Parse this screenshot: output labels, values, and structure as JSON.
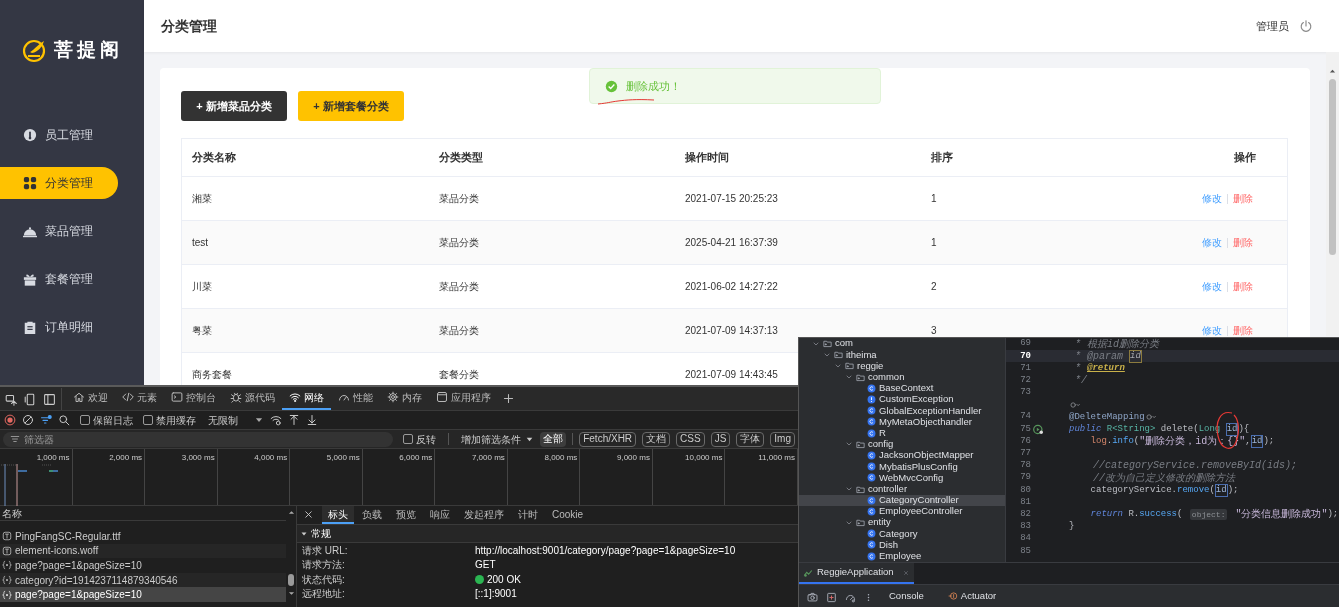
{
  "admin": {
    "logo": {
      "text": "菩提阁"
    },
    "nav": [
      {
        "label": "员工管理",
        "selected": false
      },
      {
        "label": "分类管理",
        "selected": true
      },
      {
        "label": "菜品管理",
        "selected": false
      },
      {
        "label": "套餐管理",
        "selected": false
      },
      {
        "label": "订单明细",
        "selected": false
      }
    ],
    "header": {
      "title": "分类管理",
      "user": "管理员"
    },
    "buttons": [
      {
        "label": "+ 新增菜品分类",
        "kind": "dark"
      },
      {
        "label": "+ 新增套餐分类",
        "kind": "accent"
      }
    ],
    "toast": {
      "message": "删除成功！",
      "kind": "success"
    },
    "table": {
      "columns": [
        "分类名称",
        "分类类型",
        "操作时间",
        "排序",
        "操作"
      ],
      "rows": [
        {
          "cells": [
            "湘菜",
            "菜品分类",
            "2021-07-15 20:25:23",
            "1"
          ],
          "actions": [
            "修改",
            "删除"
          ]
        },
        {
          "cells": [
            "test",
            "菜品分类",
            "2025-04-21 16:37:39",
            "1"
          ],
          "actions": [
            "修改",
            "删除"
          ]
        },
        {
          "cells": [
            "川菜",
            "菜品分类",
            "2021-06-02 14:27:22",
            "2"
          ],
          "actions": [
            "修改",
            "删除"
          ]
        },
        {
          "cells": [
            "粤菜",
            "菜品分类",
            "2021-07-09 14:37:13",
            "3"
          ],
          "actions": [
            "修改",
            "删除"
          ]
        },
        {
          "cells": [
            "商务套餐",
            "套餐分类",
            "2021-07-09 14:43:45"
          ]
        }
      ]
    }
  },
  "devtools": {
    "tabs": [
      {
        "label": "欢迎",
        "selected": false
      },
      {
        "label": "元素",
        "selected": false
      },
      {
        "label": "控制台",
        "selected": false
      },
      {
        "label": "源代码",
        "selected": false
      },
      {
        "label": "网络",
        "selected": true
      },
      {
        "label": "性能",
        "selected": false
      },
      {
        "label": "内存",
        "selected": false
      },
      {
        "label": "应用程序",
        "selected": false
      }
    ],
    "toolbar": {
      "options": [
        {
          "label": "保留日志",
          "checked": false
        },
        {
          "label": "禁用缓存",
          "checked": false
        }
      ],
      "throttle": "无限制"
    },
    "filter": {
      "placeholder": "筛选器",
      "invert": {
        "label": "反转",
        "checked": false
      },
      "more": "增加筛选条件",
      "chips": [
        {
          "label": "全部",
          "selected": true
        },
        {
          "label": "Fetch/XHR",
          "selected": false
        },
        {
          "label": "文档",
          "selected": false
        },
        {
          "label": "CSS",
          "selected": false
        },
        {
          "label": "JS",
          "selected": false
        },
        {
          "label": "字体",
          "selected": false
        },
        {
          "label": "Img",
          "selected": false
        }
      ]
    },
    "timeline": {
      "ticks": [
        "1,000 ms",
        "2,000 ms",
        "3,000 ms",
        "4,000 ms",
        "5,000 ms",
        "6,000 ms",
        "7,000 ms",
        "8,000 ms",
        "9,000 ms",
        "10,000 ms",
        "11,000 ms"
      ]
    },
    "requests": {
      "header": "名称",
      "rows": [
        {
          "name": "PingFangSC-Regular.ttf",
          "kind": "font",
          "selected": false
        },
        {
          "name": "element-icons.woff",
          "kind": "font",
          "selected": false
        },
        {
          "name": "page?page=1&pageSize=10",
          "kind": "fetch",
          "selected": false
        },
        {
          "name": "category?id=1914237114879340546",
          "kind": "fetch",
          "selected": false
        },
        {
          "name": "page?page=1&pageSize=10",
          "kind": "fetch",
          "selected": true
        }
      ]
    },
    "details": {
      "tabs": [
        {
          "label": "标头",
          "selected": true
        },
        {
          "label": "负载",
          "selected": false
        },
        {
          "label": "预览",
          "selected": false
        },
        {
          "label": "响应",
          "selected": false
        },
        {
          "label": "发起程序",
          "selected": false
        },
        {
          "label": "计时",
          "selected": false
        },
        {
          "label": "Cookie",
          "selected": false
        }
      ],
      "section": {
        "title": "常规",
        "expanded": true,
        "rows": [
          {
            "label": "请求 URL:",
            "value": "http://localhost:9001/category/page?page=1&pageSize=10",
            "kind": "text"
          },
          {
            "label": "请求方法:",
            "value": "GET",
            "kind": "text"
          },
          {
            "label": "状态代码:",
            "value": "200 OK",
            "kind": "status"
          },
          {
            "label": "远程地址:",
            "value": "[::1]:9001",
            "kind": "text"
          }
        ]
      }
    }
  },
  "ide": {
    "tree": [
      {
        "label": "com",
        "kind": "package",
        "expanded": true,
        "selected": false,
        "children": [
          {
            "label": "itheima",
            "kind": "package",
            "expanded": true,
            "selected": false,
            "children": [
              {
                "label": "reggie",
                "kind": "package",
                "expanded": true,
                "selected": false,
                "children": [
                  {
                    "label": "common",
                    "kind": "package",
                    "expanded": true,
                    "selected": false,
                    "children": [
                      {
                        "label": "BaseContext",
                        "kind": "class",
                        "selected": false
                      },
                      {
                        "label": "CustomException",
                        "kind": "exception",
                        "selected": false
                      },
                      {
                        "label": "GlobalExceptionHandler",
                        "kind": "class",
                        "selected": false
                      },
                      {
                        "label": "MyMetaObjecthandler",
                        "kind": "class",
                        "selected": false
                      },
                      {
                        "label": "R",
                        "kind": "class",
                        "selected": false
                      }
                    ]
                  },
                  {
                    "label": "config",
                    "kind": "package",
                    "expanded": true,
                    "selected": false,
                    "children": [
                      {
                        "label": "JacksonObjectMapper",
                        "kind": "class",
                        "selected": false
                      },
                      {
                        "label": "MybatisPlusConfig",
                        "kind": "class",
                        "selected": false
                      },
                      {
                        "label": "WebMvcConfig",
                        "kind": "class",
                        "selected": false
                      }
                    ]
                  },
                  {
                    "label": "controller",
                    "kind": "package",
                    "expanded": true,
                    "selected": false,
                    "children": [
                      {
                        "label": "CategoryController",
                        "kind": "class",
                        "selected": true
                      },
                      {
                        "label": "EmployeeController",
                        "kind": "class",
                        "selected": false
                      }
                    ]
                  },
                  {
                    "label": "entity",
                    "kind": "package",
                    "expanded": true,
                    "selected": false,
                    "children": [
                      {
                        "label": "Category",
                        "kind": "class",
                        "selected": false
                      },
                      {
                        "label": "Dish",
                        "kind": "class",
                        "selected": false
                      },
                      {
                        "label": "Employee",
                        "kind": "class",
                        "selected": false
                      }
                    ]
                  }
                ]
              }
            ]
          }
        ]
      }
    ],
    "code": [
      {
        "n": "69",
        "kind": "code",
        "current": false,
        "segs": [
          {
            "text": " * 根据id删除分类",
            "kind": "doc"
          }
        ]
      },
      {
        "n": "70",
        "kind": "code",
        "current": true,
        "segs": [
          {
            "text": " * @param ",
            "kind": "doc"
          },
          {
            "text": "id",
            "kind": "param-ref"
          }
        ]
      },
      {
        "n": "71",
        "kind": "code",
        "current": false,
        "segs": [
          {
            "text": " * ",
            "kind": "doc"
          },
          {
            "text": "@return",
            "kind": "doc-warn"
          }
        ]
      },
      {
        "n": "72",
        "kind": "code",
        "current": false,
        "segs": [
          {
            "text": " */",
            "kind": "doc"
          }
        ]
      },
      {
        "n": "73",
        "kind": "code",
        "current": false
      },
      {
        "kind": "code",
        "current": false,
        "segs": [
          {
            "kind": "inlay-icon"
          }
        ]
      },
      {
        "n": "74",
        "kind": "code",
        "current": false,
        "segs": [
          {
            "text": "@DeleteMapping",
            "kind": "annotation"
          },
          {
            "kind": "inlay-icon"
          }
        ]
      },
      {
        "n": "75",
        "kind": "runnable",
        "current": false,
        "segs": [
          {
            "text": "public",
            "kind": "keyword"
          },
          {
            "text": " R<String>",
            "kind": "type"
          },
          {
            "text": " delete(",
            "kind": "plain"
          },
          {
            "text": "Long ",
            "kind": "type"
          },
          {
            "text": "id",
            "kind": "ref"
          },
          {
            "text": "){",
            "kind": "plain"
          }
        ]
      },
      {
        "n": "76",
        "kind": "code",
        "current": false,
        "segs": [
          {
            "text": "    log",
            "kind": "field"
          },
          {
            "text": ".",
            "kind": "plain"
          },
          {
            "text": "info",
            "kind": "method"
          },
          {
            "text": "(",
            "kind": "plain"
          },
          {
            "text": "\"删除分类，id为：{}\"",
            "kind": "string"
          },
          {
            "text": ",",
            "kind": "plain"
          },
          {
            "text": "id",
            "kind": "ref"
          },
          {
            "text": ");",
            "kind": "plain"
          }
        ]
      },
      {
        "n": "77",
        "kind": "code",
        "current": false
      },
      {
        "n": "78",
        "kind": "code",
        "current": false,
        "segs": [
          {
            "text": "    //categoryService.removeById(ids);",
            "kind": "comment"
          }
        ]
      },
      {
        "n": "79",
        "kind": "code",
        "current": false,
        "segs": [
          {
            "text": "    //改为自己定义修改的删除方法",
            "kind": "comment"
          }
        ]
      },
      {
        "n": "80",
        "kind": "code",
        "current": false,
        "segs": [
          {
            "text": "    categoryService.",
            "kind": "plain"
          },
          {
            "text": "remove",
            "kind": "method"
          },
          {
            "text": "(",
            "kind": "plain"
          },
          {
            "text": "id",
            "kind": "ref"
          },
          {
            "text": ");",
            "kind": "plain"
          }
        ]
      },
      {
        "n": "81",
        "kind": "code",
        "current": false
      },
      {
        "n": "82",
        "kind": "code",
        "current": false,
        "segs": [
          {
            "text": "    return",
            "kind": "keyword"
          },
          {
            "text": " R.",
            "kind": "plain"
          },
          {
            "text": "success",
            "kind": "method"
          },
          {
            "text": "( ",
            "kind": "plain"
          },
          {
            "text": "object:",
            "kind": "hint"
          },
          {
            "text": " \"分类信息删除成功\"",
            "kind": "string"
          },
          {
            "text": ");",
            "kind": "plain"
          }
        ]
      },
      {
        "n": "83",
        "kind": "code",
        "current": false,
        "segs": [
          {
            "text": "}",
            "kind": "plain"
          }
        ]
      },
      {
        "n": "84",
        "kind": "code",
        "current": false
      },
      {
        "n": "85",
        "kind": "code",
        "current": false
      }
    ],
    "run_tab": {
      "label": "ReggieApplication"
    },
    "bottom_tabs": [
      {
        "label": "Console",
        "selected": true
      },
      {
        "label": "Actuator",
        "selected": false
      }
    ]
  }
}
